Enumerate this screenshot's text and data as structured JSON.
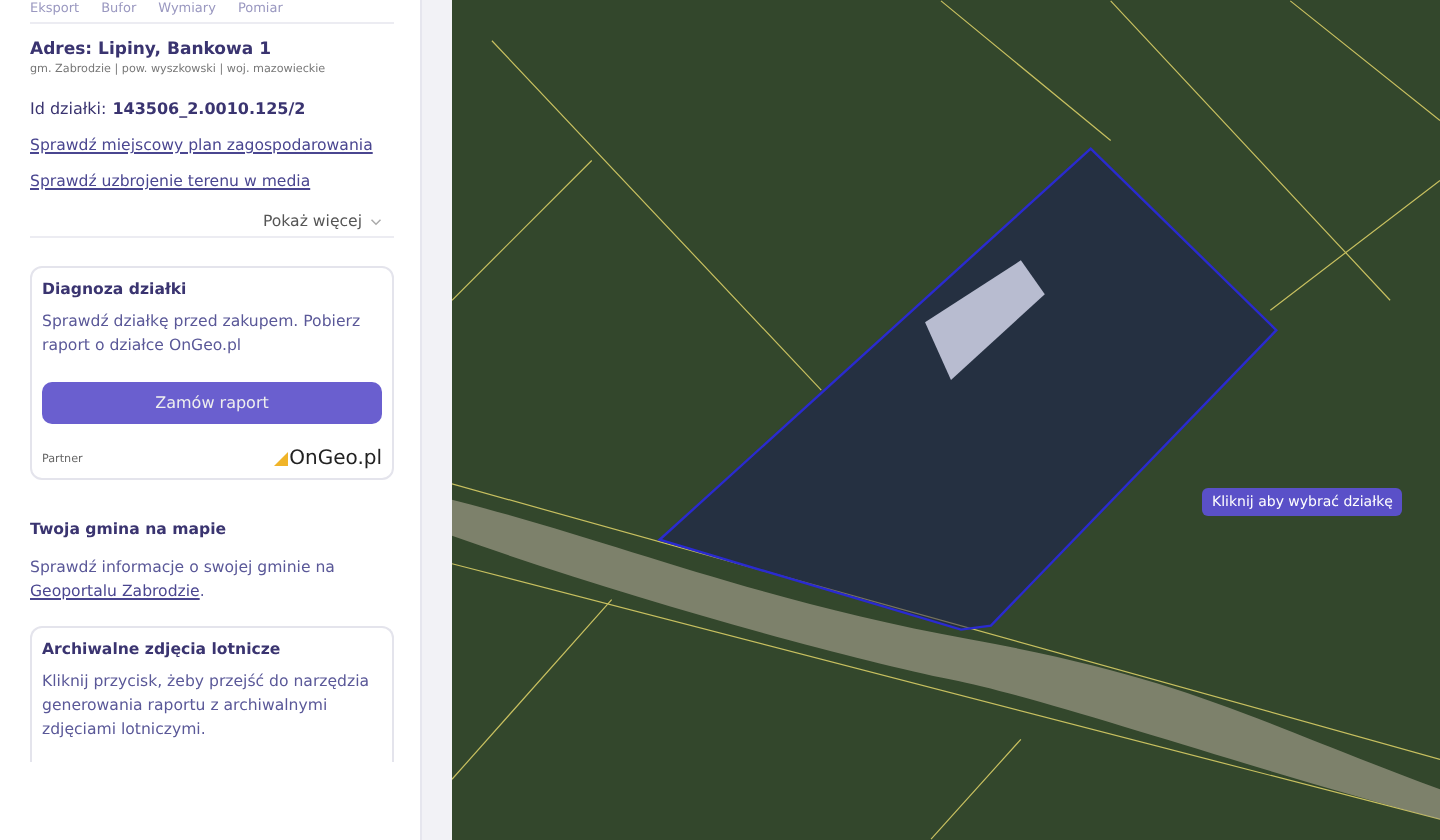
{
  "toolbar": [
    "Eksport",
    "Bufor",
    "Wymiary",
    "Pomiar"
  ],
  "address": {
    "title": "Adres: Lipiny, Bankowa 1",
    "subtitle": "gm. Zabrodzie | pow. wyszkowski | woj. mazowieckie"
  },
  "parcel_id": {
    "label": "Id działki:",
    "value": "143506_2.0010.125/2"
  },
  "links": [
    "Sprawdź miejscowy plan zagospodarowania",
    "Sprawdź uzbrojenie terenu w media"
  ],
  "show_more": "Pokaż więcej",
  "diagnosis_card": {
    "title": "Diagnoza działki",
    "text": "Sprawdź działkę przed zakupem. Pobierz raport o działce OnGeo.pl",
    "button": "Zamów raport",
    "partner_label": "Partner",
    "partner_logo": "OnGeo.pl"
  },
  "municipality": {
    "title": "Twoja gmina na mapie",
    "text": "Sprawdź informacje o swojej gminie na",
    "link": "Geoportalu Zabrodzie",
    "suffix": "."
  },
  "archive_card": {
    "title": "Archiwalne zdjęcia lotnicze",
    "text": "Kliknij przycisk, żeby przejść do narzędzia generowania raportu z archiwalnymi zdjęciami lotniczymi."
  },
  "map": {
    "tooltip": "Kliknij aby wybrać działkę"
  }
}
